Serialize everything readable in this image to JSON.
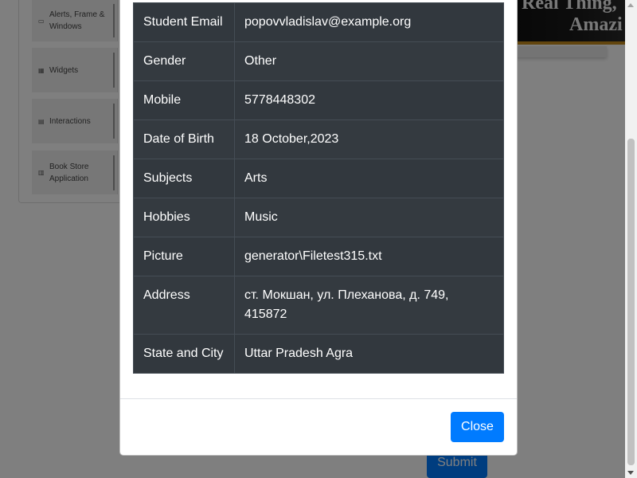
{
  "sidebar": {
    "groups": [
      {
        "label": "Alerts, Frame & Windows",
        "icon": "window-icon"
      },
      {
        "label": "Widgets",
        "icon": "grid-icon"
      },
      {
        "label": "Interactions",
        "icon": "list-icon"
      },
      {
        "label": "Book Store Application",
        "icon": "books-icon"
      }
    ]
  },
  "banner": {
    "line1": "Real Thing,",
    "line2": "Amazi"
  },
  "form": {
    "submit_label": "Submit"
  },
  "modal": {
    "rows": [
      {
        "label": "Student Email",
        "value": "popovvladislav@example.org"
      },
      {
        "label": "Gender",
        "value": "Other"
      },
      {
        "label": "Mobile",
        "value": "5778448302"
      },
      {
        "label": "Date of Birth",
        "value": "18 October,2023"
      },
      {
        "label": "Subjects",
        "value": "Arts"
      },
      {
        "label": "Hobbies",
        "value": "Music"
      },
      {
        "label": "Picture",
        "value": "generator\\Filetest315.txt"
      },
      {
        "label": "Address",
        "value": "ст. Мокшан, ул. Плеханова, д. 749, 415872"
      },
      {
        "label": "State and City",
        "value": "Uttar Pradesh Agra"
      }
    ],
    "close_label": "Close"
  },
  "colors": {
    "primary": "#007bff",
    "table_dark": "#343a40",
    "table_dark_stripe": "#32383e",
    "banner_accent": "#c58a1c"
  }
}
